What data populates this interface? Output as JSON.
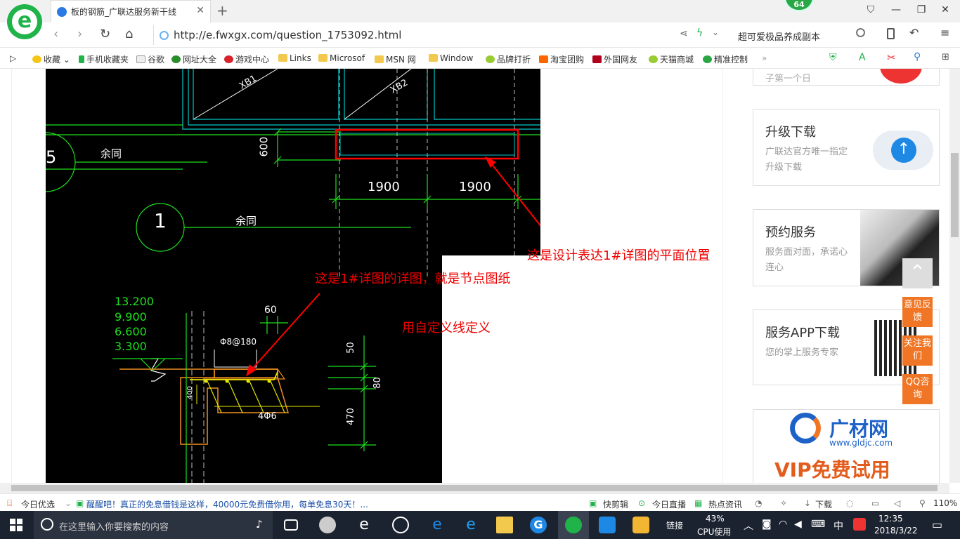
{
  "browser": {
    "tab_title": "板的钢筋_广联达服务新干线",
    "badge": "64",
    "url": "http://e.fwxgx.com/question_1753092.html",
    "search_suggestion": "超可爱极品养成副本"
  },
  "bookmarks": [
    "收藏",
    "手机收藏夹",
    "谷歌",
    "网址大全",
    "游戏中心",
    "Links",
    "Microsof",
    "MSN 网",
    "Window",
    "品牌打折",
    "淘宝团购",
    "外国网友",
    "天猫商城",
    "精准控制"
  ],
  "cad": {
    "labels": {
      "xb1": "XB1",
      "xb2": "XB2",
      "dim600": "600",
      "dim1900a": "1900",
      "dim1900b": "1900",
      "yutong1": "余同",
      "yutong2": "余同",
      "axis5": "5",
      "axis1": "1",
      "elev1": "13.200",
      "elev2": "9.900",
      "elev3": "6.600",
      "elev4": "3.300",
      "dim60": "60",
      "rebar": "Φ8@180",
      "dim400": "400",
      "rebar4": "4Φ6",
      "dim50": "50",
      "dim80": "80",
      "dim470": "470"
    }
  },
  "annotations": {
    "plan_position": "这是设计表达1#详图的平面位置",
    "detail": "这是1#详图的详图，就是节点图纸",
    "custom_line": "用自定义线定义"
  },
  "sidebar": {
    "upgrade": {
      "title": "升级下载",
      "desc": "广联达官方唯一指定升级下载"
    },
    "booking": {
      "title": "预约服务",
      "desc": "服务面对面，承诺心连心"
    },
    "app": {
      "title": "服务APP下载",
      "desc": "您的掌上服务专家"
    },
    "ad_brand": "广材网",
    "ad_url": "www.gldjc.com",
    "ad_vip": "VIP免费试用",
    "top_partial": "子第一个日"
  },
  "side_buttons": {
    "feedback": "意见反馈",
    "follow": "关注我们",
    "qq": "QQ咨询"
  },
  "statusbar": {
    "today": "今日优选",
    "news": "醒醒吧！真正的免息借钱是这样，40000元免费借你用，每单免息30天！...",
    "kuaijian": "快剪辑",
    "live": "今日直播",
    "hot": "热点资讯",
    "download": "下载",
    "zoom": "110%"
  },
  "taskbar": {
    "search_placeholder": "在这里输入你要搜索的内容",
    "link": "链接",
    "cpu_percent": "43%",
    "cpu_label": "CPU使用",
    "ime": "中",
    "time": "12:35",
    "date": "2018/3/22"
  },
  "colors": {
    "accent_green": "#1fb34a",
    "annotation_red": "#e00000",
    "side_orange": "#f07524",
    "cad_green": "#1ee01e",
    "cad_cyan": "#00c8c8",
    "cad_yellow": "#e6e600",
    "cad_orange": "#f09020"
  }
}
